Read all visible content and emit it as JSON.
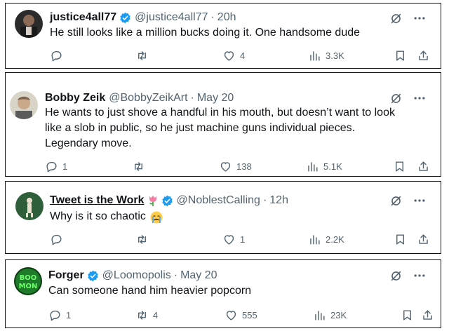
{
  "colors": {
    "verified": "#1d9bf0",
    "muted": "#536471",
    "text": "#0f1419",
    "border": "#111111"
  },
  "icons": {
    "reply": "reply-icon",
    "repost": "repost-icon",
    "like": "like-icon",
    "views": "views-icon",
    "bookmark": "bookmark-icon",
    "share": "share-icon",
    "grok": "grok-slash-icon",
    "more": "more-icon",
    "verified": "verified-badge-icon"
  },
  "tweets": [
    {
      "name": "justice4all77",
      "handle": "@justice4all77",
      "separator": "·",
      "time": "20h",
      "text": "He still looks like a million bucks doing it. One handsome dude",
      "reply_count": "",
      "repost_count": "",
      "like_count": "4",
      "view_count": "3.3K"
    },
    {
      "name": "Bobby Zeik",
      "handle": "@BobbyZeikArt",
      "separator": "·",
      "time": "May 20",
      "text": "He wants to just shove a handful in his mouth, but doesn’t want to look like a slob in public, so he just machine guns individual pieces. Legendary move.",
      "reply_count": "1",
      "repost_count": "",
      "like_count": "138",
      "view_count": "5.1K"
    },
    {
      "name": "Tweet is the Work",
      "name_emoji": "tulip-emoji",
      "handle": "@NoblestCalling",
      "separator": "·",
      "time": "12h",
      "text": "Why is it so chaotic",
      "text_emoji": "crying-face-emoji",
      "reply_count": "",
      "repost_count": "",
      "like_count": "1",
      "view_count": "2.2K"
    },
    {
      "name": "Forger",
      "handle": "@Loomopolis",
      "separator": "·",
      "time": "May 20",
      "text": "Can someone hand him heavier popcorn",
      "reply_count": "1",
      "repost_count": "4",
      "like_count": "555",
      "view_count": "23K",
      "avatar_text": "BOO MON"
    }
  ]
}
